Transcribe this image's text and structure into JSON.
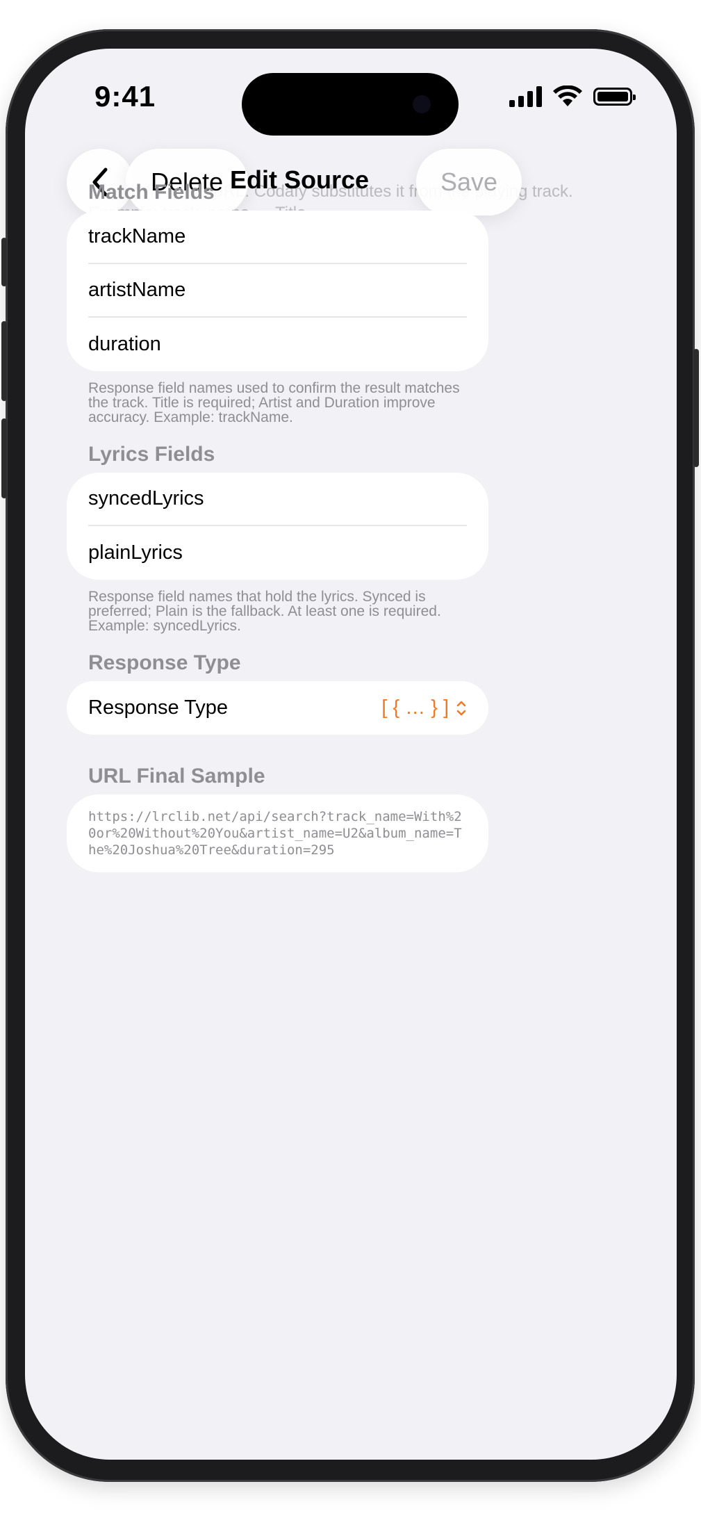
{
  "status": {
    "time": "9:41"
  },
  "nav": {
    "delete_label": "Delete",
    "title": "Edit Source",
    "save_label": "Save"
  },
  "scrolled_text": "…used fill in the URL. Codafy substitutes it from the playing track. Example: track_name → Title.",
  "match_fields": {
    "header": "Match Fields",
    "items": [
      "trackName",
      "artistName",
      "duration"
    ],
    "footnote": "Response field names used to confirm the result matches the track. Title is required; Artist and Duration improve accuracy. Example: trackName."
  },
  "lyrics_fields": {
    "header": "Lyrics Fields",
    "items": [
      "syncedLyrics",
      "plainLyrics"
    ],
    "footnote": "Response field names that hold the lyrics. Synced is preferred; Plain is the fallback. At least one is required. Example: syncedLyrics."
  },
  "response_type": {
    "header": "Response Type",
    "label": "Response Type",
    "value": "[ { … } ]"
  },
  "url_sample": {
    "header": "URL Final Sample",
    "value": "https://lrclib.net/api/search?track_name=With%20or%20Without%20You&artist_name=U2&album_name=The%20Joshua%20Tree&duration=295"
  }
}
